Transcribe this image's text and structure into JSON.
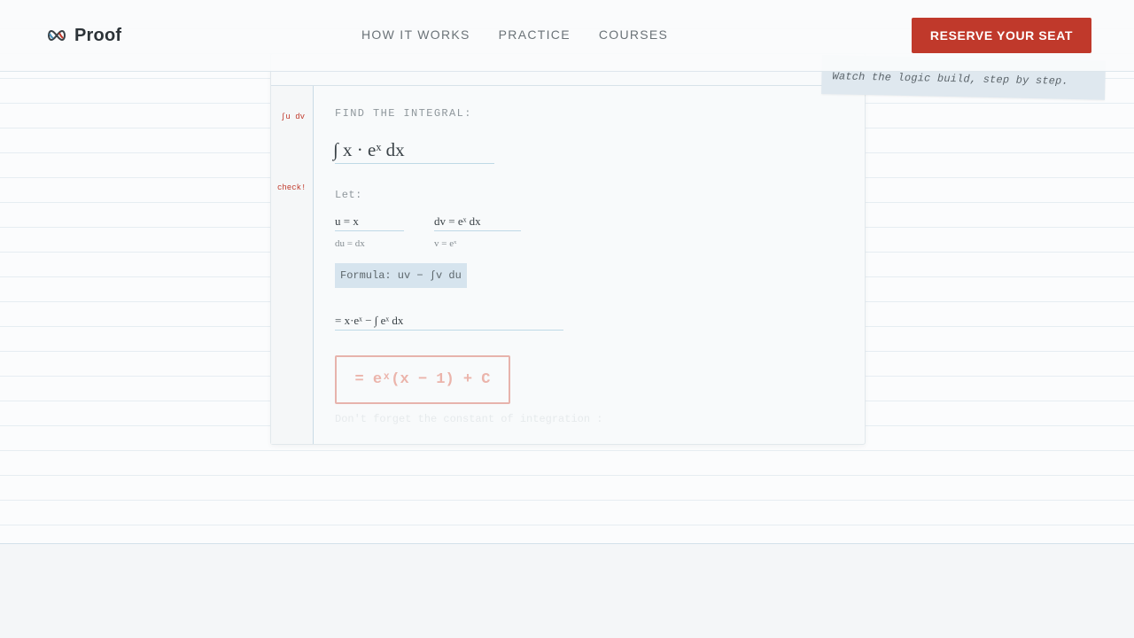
{
  "brand": {
    "name": "Proof"
  },
  "nav": [
    {
      "label": "HOW IT WORKS"
    },
    {
      "label": "PRACTICE"
    },
    {
      "label": "COURSES"
    }
  ],
  "cta": {
    "label": "RESERVE YOUR SEAT"
  },
  "sticky_note": {
    "text": "Watch the logic build, step by step."
  },
  "notebook": {
    "margin_notes": [
      "∫u dv",
      "check!"
    ],
    "prompt": "FIND THE INTEGRAL:",
    "problem": "∫ x · eˣ dx",
    "let_label": "Let:",
    "u": "u = x",
    "du": "du = dx",
    "dv": "dv = eˣ dx",
    "v": "v = eˣ",
    "formula": "Formula: uv − ∫v du",
    "step": "= x·eˣ − ∫ eˣ dx",
    "answer": "= eˣ(x − 1) + C",
    "hint": "Don't forget the constant of integration :"
  },
  "colors": {
    "accent": "#c0392b",
    "paper": "#fbfcfd",
    "highlight": "#d6e4ee"
  },
  "icons": {
    "logo": "infinity-logo-icon"
  }
}
